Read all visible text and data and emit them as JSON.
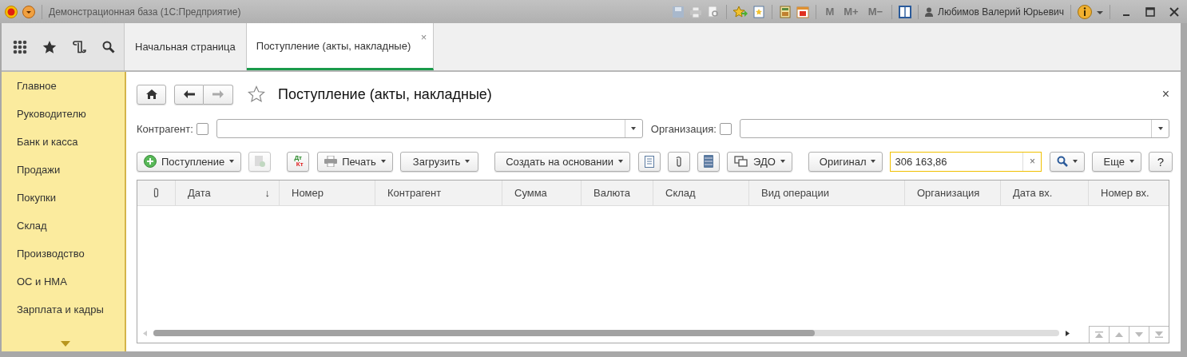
{
  "window": {
    "title": "Демонстрационная база  (1С:Предприятие)",
    "memory_buttons": [
      "M",
      "M+",
      "M−"
    ],
    "user": "Любимов Валерий Юрьевич"
  },
  "tabs": [
    {
      "label": "Начальная страница",
      "selected": false
    },
    {
      "label": "Поступление (акты, накладные)",
      "selected": true,
      "close": "×"
    }
  ],
  "sidebar": {
    "items": [
      {
        "label": "Главное"
      },
      {
        "label": "Руководителю"
      },
      {
        "label": "Банк и касса"
      },
      {
        "label": "Продажи"
      },
      {
        "label": "Покупки"
      },
      {
        "label": "Склад"
      },
      {
        "label": "Производство"
      },
      {
        "label": "ОС и НМА"
      },
      {
        "label": "Зарплата и кадры"
      }
    ]
  },
  "form": {
    "title": "Поступление (акты, накладные)",
    "close": "×",
    "filters": [
      {
        "label": "Контрагент:",
        "checked": false
      },
      {
        "label": "Организация:",
        "checked": false
      }
    ],
    "commands": [
      {
        "label": "Поступление"
      },
      {
        "label": "Печать"
      },
      {
        "label": "Загрузить"
      },
      {
        "label": "Создать на основании"
      },
      {
        "label": "ЭДО"
      },
      {
        "label": "Оригинал"
      },
      {
        "label": "Еще"
      },
      {
        "label": "?"
      }
    ],
    "dt_kt": [
      "Дт",
      "Кт"
    ],
    "search": {
      "value": "306 163,86",
      "clear": "×"
    },
    "table": {
      "columns": [
        {
          "label": "Дата",
          "sort_mark": "↓"
        },
        {
          "label": "Номер"
        },
        {
          "label": "Контрагент"
        },
        {
          "label": "Сумма"
        },
        {
          "label": "Валюта"
        },
        {
          "label": "Склад"
        },
        {
          "label": "Вид операции"
        },
        {
          "label": "Организация"
        },
        {
          "label": "Дата вх."
        },
        {
          "label": "Номер вх."
        }
      ]
    }
  }
}
